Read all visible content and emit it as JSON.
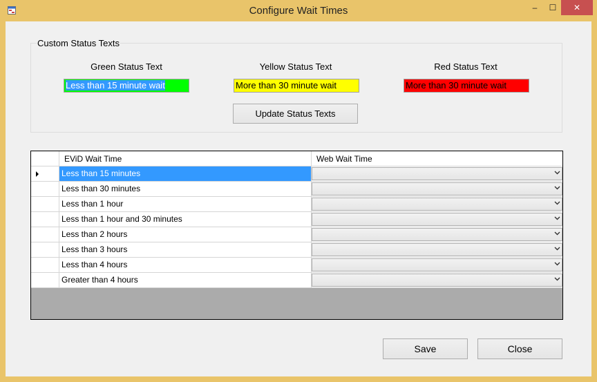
{
  "window": {
    "title": "Configure Wait Times",
    "accent_color": "#e9c46a",
    "icon": "app-form-icon",
    "controls": {
      "minimize": "–",
      "maximize": "☐",
      "close": "✕"
    }
  },
  "status_texts": {
    "group_title": "Custom Status Texts",
    "green": {
      "label": "Green Status Text",
      "value": "Less than 15 minute wait",
      "color": "#00ff00"
    },
    "yellow": {
      "label": "Yellow Status Text",
      "value": "More than 30 minute wait",
      "color": "#ffff00"
    },
    "red": {
      "label": "Red Status Text",
      "value": "More than 30 minute wait",
      "color": "#ff0000"
    },
    "update_button": "Update Status Texts"
  },
  "grid": {
    "columns": [
      "EViD Wait Time",
      "Web Wait Time"
    ],
    "rows": [
      {
        "evid": "Less than 15 minutes",
        "web": ""
      },
      {
        "evid": "Less than 30 minutes",
        "web": ""
      },
      {
        "evid": "Less than 1 hour",
        "web": ""
      },
      {
        "evid": "Less than 1 hour and 30 minutes",
        "web": ""
      },
      {
        "evid": "Less than 2 hours",
        "web": ""
      },
      {
        "evid": "Less than 3 hours",
        "web": ""
      },
      {
        "evid": "Less than 4 hours",
        "web": ""
      },
      {
        "evid": "Greater than 4 hours",
        "web": ""
      }
    ],
    "selected_row": 0,
    "selection_color": "#3399ff",
    "dropdown_icon": "chevron-down-icon"
  },
  "buttons": {
    "save": "Save",
    "close": "Close"
  }
}
